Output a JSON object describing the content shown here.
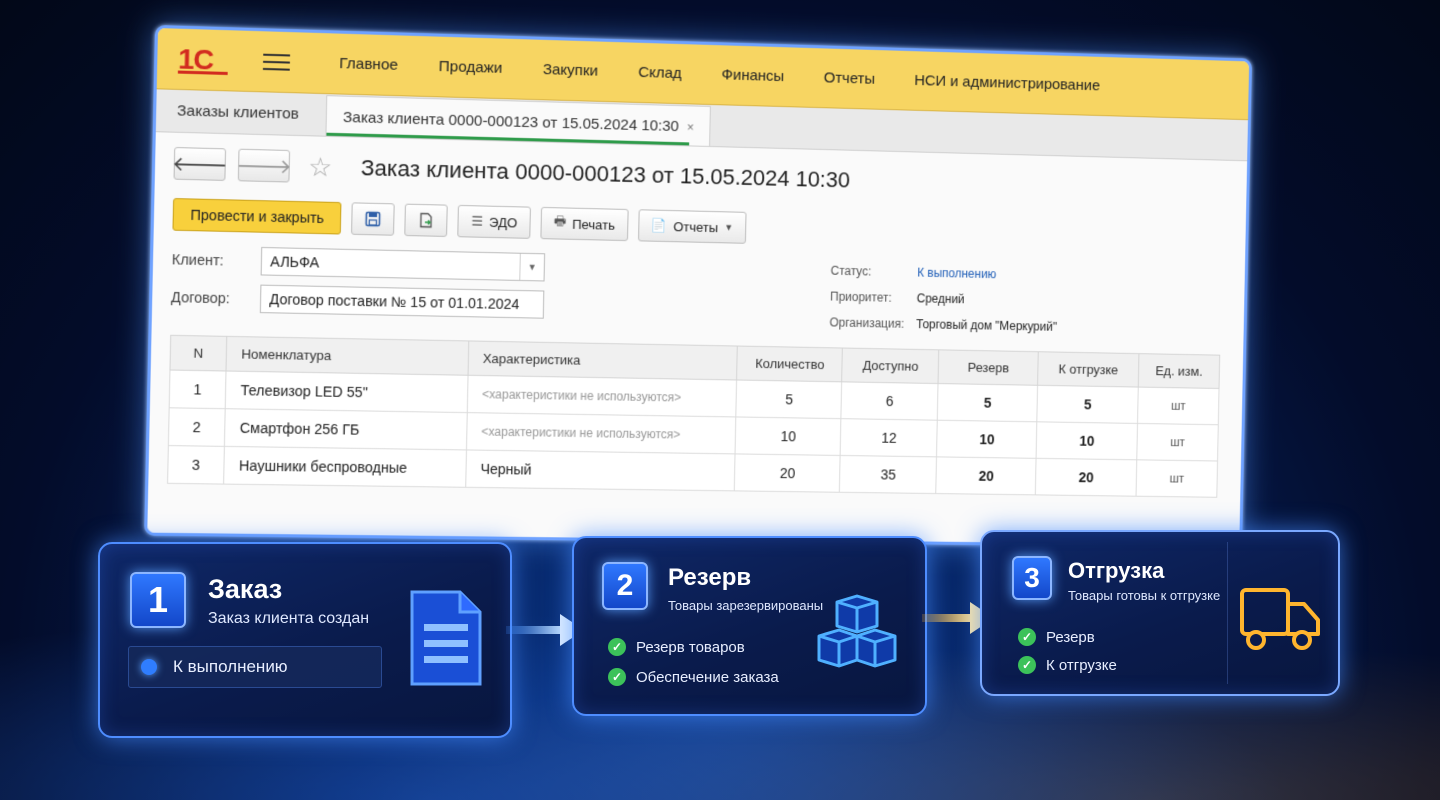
{
  "app": {
    "logo": "1С",
    "menu": [
      "Главное",
      "Продажи",
      "Закупки",
      "Склад",
      "Финансы",
      "Отчеты",
      "НСИ и администрирование"
    ],
    "tabs": {
      "home": "Заказы клиентов",
      "active": "Заказ клиента 0000-000123 от 15.05.2024 10:30",
      "close": "×"
    }
  },
  "document": {
    "title": "Заказ клиента 0000-000123 от 15.05.2024 10:30",
    "toolbar": {
      "post_close": "Провести и закрыть",
      "edo": "ЭДО",
      "print": "Печать",
      "reports": "Отчеты"
    },
    "fields": {
      "client_label": "Клиент:",
      "client_value": "АЛЬФА",
      "contract_label": "Договор:",
      "contract_value": "Договор поставки № 15 от 01.01.2024"
    },
    "props": {
      "status_label": "Статус:",
      "status_value": "К выполнению",
      "priority_label": "Приоритет:",
      "priority_value": "Средний",
      "org_label": "Организация:",
      "org_value": "Торговый дом \"Меркурий\""
    },
    "table": {
      "headers": [
        "N",
        "Номенклатура",
        "Характеристика",
        "Количество",
        "Доступно",
        "Резерв",
        "К отгрузке",
        "Ед. изм."
      ],
      "rows": [
        [
          "1",
          "Телевизор LED 55\"",
          "<характеристики не используются>",
          "5",
          "6",
          "5",
          "5",
          "шт"
        ],
        [
          "2",
          "Смартфон 256 ГБ",
          "<характеристики не используются>",
          "10",
          "12",
          "10",
          "10",
          "шт"
        ],
        [
          "3",
          "Наушники беспроводные",
          "Черный",
          "20",
          "35",
          "20",
          "20",
          "шт"
        ]
      ]
    }
  },
  "steps": [
    {
      "num": "1",
      "title": "Заказ",
      "subtitle": "Заказ клиента создан",
      "status": "К выполнению",
      "icon": "document-icon"
    },
    {
      "num": "2",
      "title": "Резерв",
      "subtitle": "Товары зарезервированы",
      "checks": [
        "Резерв товаров",
        "Обеспечение заказа"
      ],
      "icon": "boxes-icon"
    },
    {
      "num": "3",
      "title": "Отгрузка",
      "subtitle": "Товары готовы к отгрузке",
      "checks": [
        "Резерв",
        "К отгрузке"
      ],
      "icon": "truck-icon"
    }
  ],
  "colors": {
    "topbar": "#f7d562",
    "primary_button": "#f8d03c",
    "link": "#2260b8",
    "card_border": "#4e8dff",
    "check_green": "#3cc25a",
    "truck_orange": "#ffb52e"
  }
}
